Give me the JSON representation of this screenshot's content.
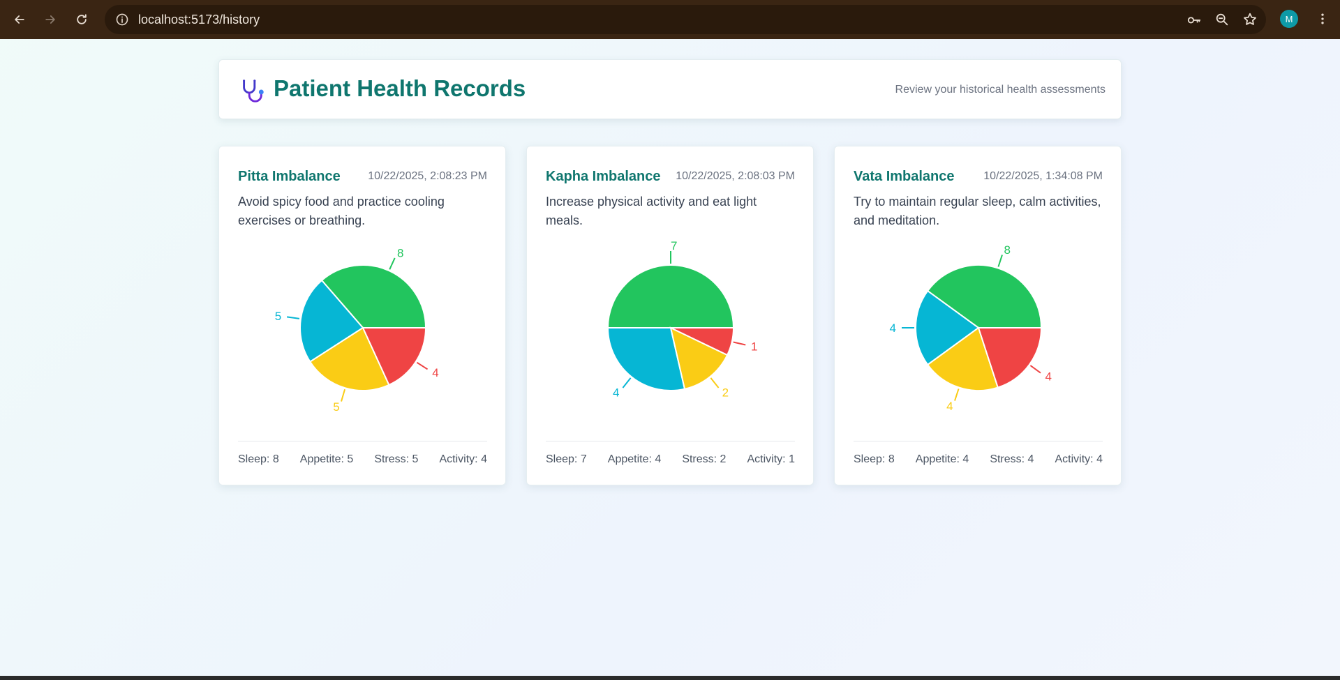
{
  "browser": {
    "url": "localhost:5173/history",
    "profile_initial": "M",
    "icons": [
      "back-icon",
      "forward-icon",
      "reload-icon",
      "info-icon",
      "key-icon",
      "zoom-icon",
      "star-icon",
      "menu-icon"
    ]
  },
  "header": {
    "title": "Patient Health Records",
    "subtitle": "Review your historical health assessments",
    "icon": "stethoscope-icon"
  },
  "colors": {
    "sleep": "#22c55e",
    "appetite": "#06b6d4",
    "stress": "#facc15",
    "activity": "#ef4444",
    "accent": "#0f766e"
  },
  "records": [
    {
      "title": "Pitta Imbalance",
      "date": "10/22/2025, 2:08:23 PM",
      "advice": "Avoid spicy food and practice cooling exercises or breathing.",
      "stats": [
        {
          "text": "Sleep: 8"
        },
        {
          "text": "Appetite: 5"
        },
        {
          "text": "Stress: 5"
        },
        {
          "text": "Activity: 4"
        }
      ],
      "chart_data": {
        "type": "pie",
        "categories": [
          "Sleep",
          "Appetite",
          "Stress",
          "Activity"
        ],
        "values": [
          8,
          5,
          5,
          4
        ],
        "title": ""
      }
    },
    {
      "title": "Kapha Imbalance",
      "date": "10/22/2025, 2:08:03 PM",
      "advice": "Increase physical activity and eat light meals.",
      "stats": [
        {
          "text": "Sleep: 7"
        },
        {
          "text": "Appetite: 4"
        },
        {
          "text": "Stress: 2"
        },
        {
          "text": "Activity: 1"
        }
      ],
      "chart_data": {
        "type": "pie",
        "categories": [
          "Sleep",
          "Appetite",
          "Stress",
          "Activity"
        ],
        "values": [
          7,
          4,
          2,
          1
        ],
        "title": ""
      }
    },
    {
      "title": "Vata Imbalance",
      "date": "10/22/2025, 1:34:08 PM",
      "advice": "Try to maintain regular sleep, calm activities, and meditation.",
      "stats": [
        {
          "text": "Sleep: 8"
        },
        {
          "text": "Appetite: 4"
        },
        {
          "text": "Stress: 4"
        },
        {
          "text": "Activity: 4"
        }
      ],
      "chart_data": {
        "type": "pie",
        "categories": [
          "Sleep",
          "Appetite",
          "Stress",
          "Activity"
        ],
        "values": [
          8,
          4,
          4,
          4
        ],
        "title": ""
      }
    }
  ]
}
